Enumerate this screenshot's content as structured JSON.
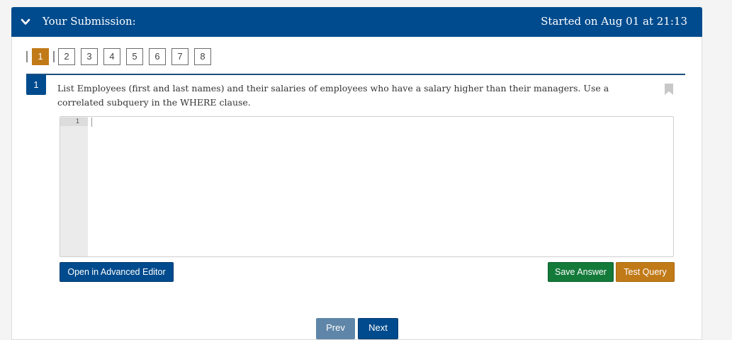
{
  "header": {
    "title": "Your Submission:",
    "started": "Started on Aug 01 at 21:13",
    "background": "#004b8d"
  },
  "pager": {
    "pages": [
      "1",
      "2",
      "3",
      "4",
      "5",
      "6",
      "7",
      "8"
    ],
    "active": "1",
    "active_color": "#c17a18"
  },
  "question": {
    "number": "1",
    "text": "List Employees (first and last names) and their salaries of employees who have a salary higher than their managers.  Use a correlated subquery in the WHERE clause.",
    "bookmark_icon": "bookmark-icon"
  },
  "editor": {
    "line_numbers": [
      "1"
    ],
    "content": ""
  },
  "buttons": {
    "advanced_editor": "Open in Advanced Editor",
    "save_answer": "Save Answer",
    "test_query": "Test Query",
    "prev": "Prev",
    "next": "Next"
  },
  "icons": {
    "collapse": "chevron-down-icon"
  }
}
